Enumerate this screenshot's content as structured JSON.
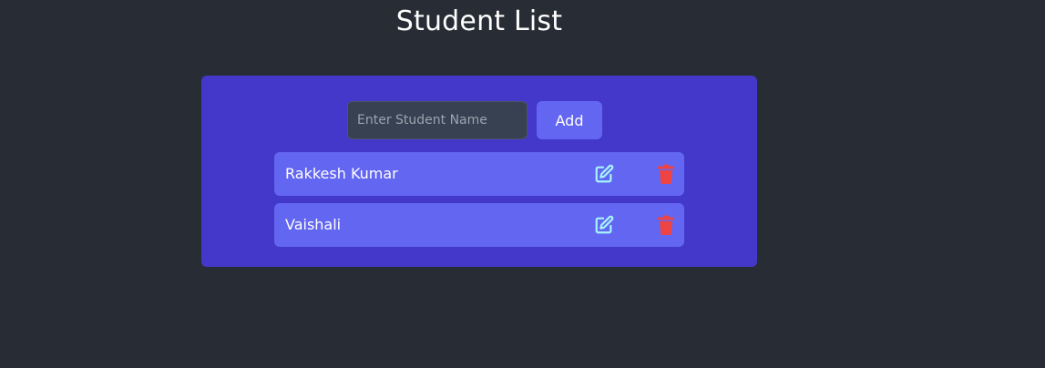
{
  "page": {
    "title": "Student List"
  },
  "form": {
    "input_value": "",
    "placeholder": "Enter Student Name",
    "add_label": "Add"
  },
  "students": [
    {
      "name": "Rakkesh Kumar"
    },
    {
      "name": "Vaishali"
    }
  ],
  "icons": {
    "edit": "edit-icon",
    "delete": "trash-icon"
  },
  "colors": {
    "background": "#282c34",
    "card": "#4338ca",
    "item": "#6366f1",
    "edit_icon": "#a5f3fc",
    "delete_icon": "#ef4444"
  }
}
